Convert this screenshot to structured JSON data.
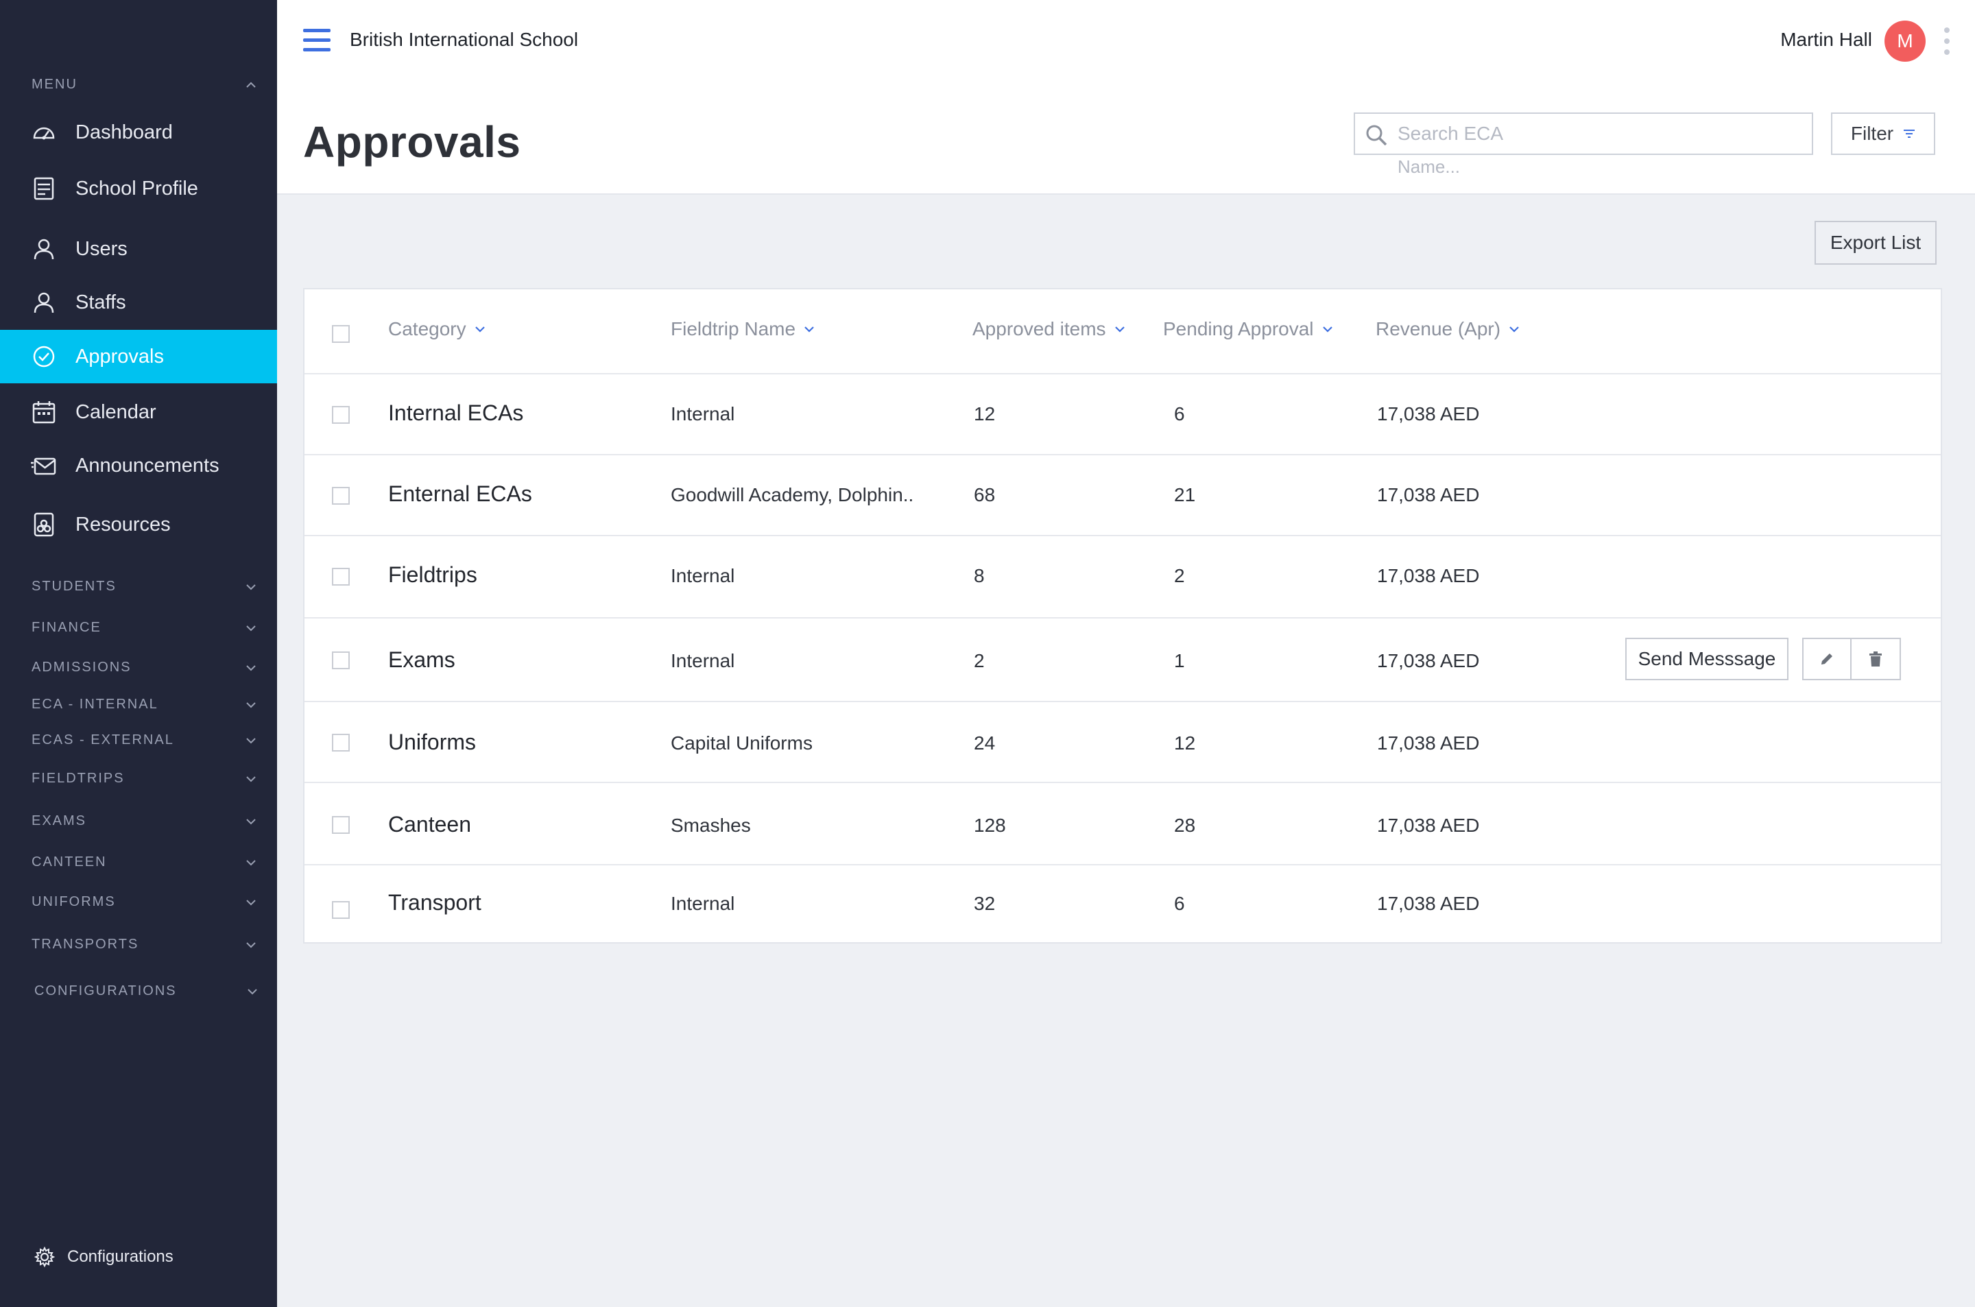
{
  "app": {
    "school_name": "British International School",
    "user_name": "Martin Hall",
    "avatar_initial": "M"
  },
  "sidebar": {
    "menu_label": "MENU",
    "items": [
      {
        "label": "Dashboard",
        "icon": "dashboard-icon"
      },
      {
        "label": "School Profile",
        "icon": "school-profile-icon"
      },
      {
        "label": "Users",
        "icon": "user-icon"
      },
      {
        "label": "Staffs",
        "icon": "user-icon"
      },
      {
        "label": "Approvals",
        "icon": "check-circle-icon",
        "active": true
      },
      {
        "label": "Calendar",
        "icon": "calendar-icon"
      },
      {
        "label": "Announcements",
        "icon": "mail-icon"
      },
      {
        "label": "Resources",
        "icon": "resources-icon"
      }
    ],
    "sections": [
      "STUDENTS",
      "FINANCE",
      "ADMISSIONS",
      "ECA - INTERNAL",
      "ECAS - EXTERNAL",
      "FIELDTRIPS",
      "EXAMS",
      "CANTEEN",
      "UNIFORMS",
      "TRANSPORTS",
      "CONFIGURATIONS"
    ],
    "footer_label": "Configurations"
  },
  "page": {
    "title": "Approvals",
    "search_placeholder": "Search ECA",
    "search_hint": "Name...",
    "filter_label": "Filter",
    "export_label": "Export List"
  },
  "table": {
    "headers": {
      "category": "Category",
      "fieldtrip": "Fieldtrip Name",
      "approved": "Approved items",
      "pending": "Pending Approval",
      "revenue": "Revenue (Apr)"
    },
    "rows": [
      {
        "category": "Internal ECAs",
        "fieldtrip": "Internal",
        "approved": "12",
        "pending": "6",
        "revenue": "17,038 AED"
      },
      {
        "category": "Enternal ECAs",
        "fieldtrip": "Goodwill Academy, Dolphin..",
        "approved": "68",
        "pending": "21",
        "revenue": "17,038 AED"
      },
      {
        "category": "Fieldtrips",
        "fieldtrip": "Internal",
        "approved": "8",
        "pending": "2",
        "revenue": "17,038 AED"
      },
      {
        "category": "Exams",
        "fieldtrip": "Internal",
        "approved": "2",
        "pending": "1",
        "revenue": "17,038 AED"
      },
      {
        "category": "Uniforms",
        "fieldtrip": "Capital Uniforms",
        "approved": "24",
        "pending": "12",
        "revenue": "17,038 AED"
      },
      {
        "category": "Canteen",
        "fieldtrip": "Smashes",
        "approved": "128",
        "pending": "28",
        "revenue": "17,038 AED"
      },
      {
        "category": "Transport",
        "fieldtrip": "Internal",
        "approved": "32",
        "pending": "6",
        "revenue": "17,038 AED"
      }
    ],
    "row_action_label": "Send Messsage"
  },
  "colors": {
    "sidebar_bg": "#222639",
    "active_item": "#00c2f0",
    "accent_blue": "#3e6fe0",
    "avatar_bg": "#f25d5d"
  }
}
